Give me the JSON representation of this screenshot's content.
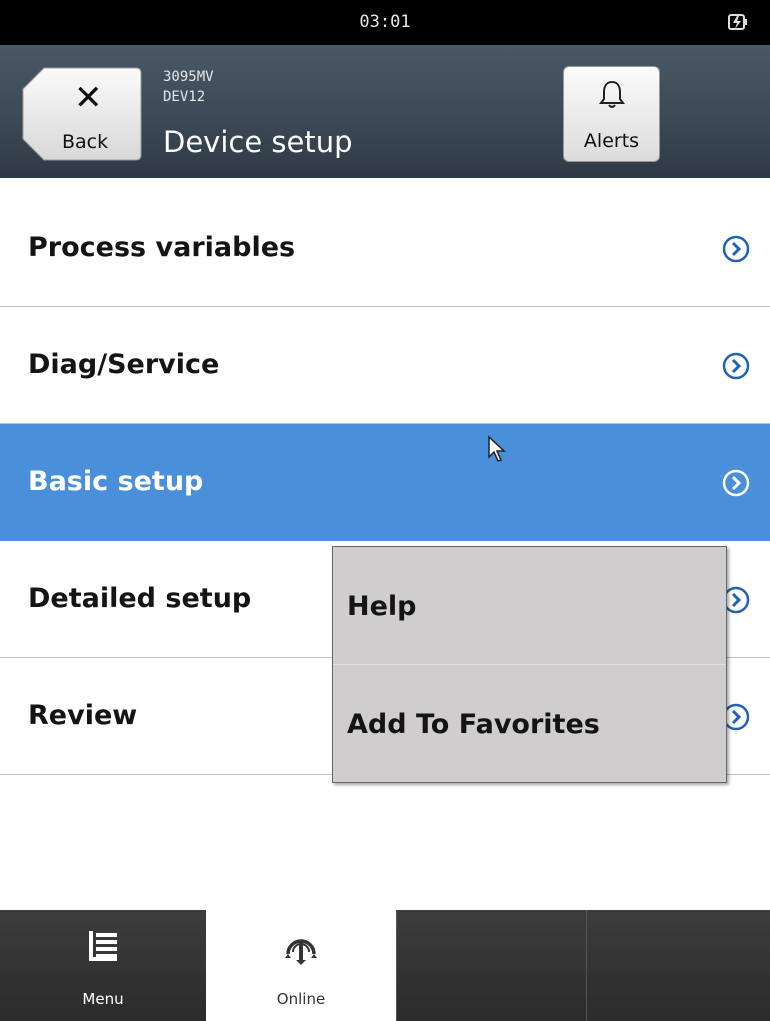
{
  "status_bar": {
    "time": "03:01",
    "battery_icon": "battery-charging-icon"
  },
  "header": {
    "back_label": "Back",
    "device_model": "3095MV",
    "device_tag": "DEV12",
    "title": "Device setup",
    "alerts_label": "Alerts"
  },
  "menu": {
    "items": [
      {
        "label": "Process variables"
      },
      {
        "label": "Diag/Service"
      },
      {
        "label": "Basic setup",
        "selected": true
      },
      {
        "label": "Detailed setup"
      },
      {
        "label": "Review"
      }
    ]
  },
  "context_menu": {
    "items": [
      {
        "label": "Help"
      },
      {
        "label": "Add To Favorites"
      }
    ]
  },
  "tab_bar": {
    "tabs": [
      {
        "label": "Menu",
        "icon": "menu-list-icon"
      },
      {
        "label": "Online",
        "icon": "online-gauge-icon",
        "active": true
      }
    ]
  },
  "colors": {
    "selected_row": "#4a8fd9",
    "chevron": "#1f63b8",
    "header_bg": "#3c4956"
  }
}
